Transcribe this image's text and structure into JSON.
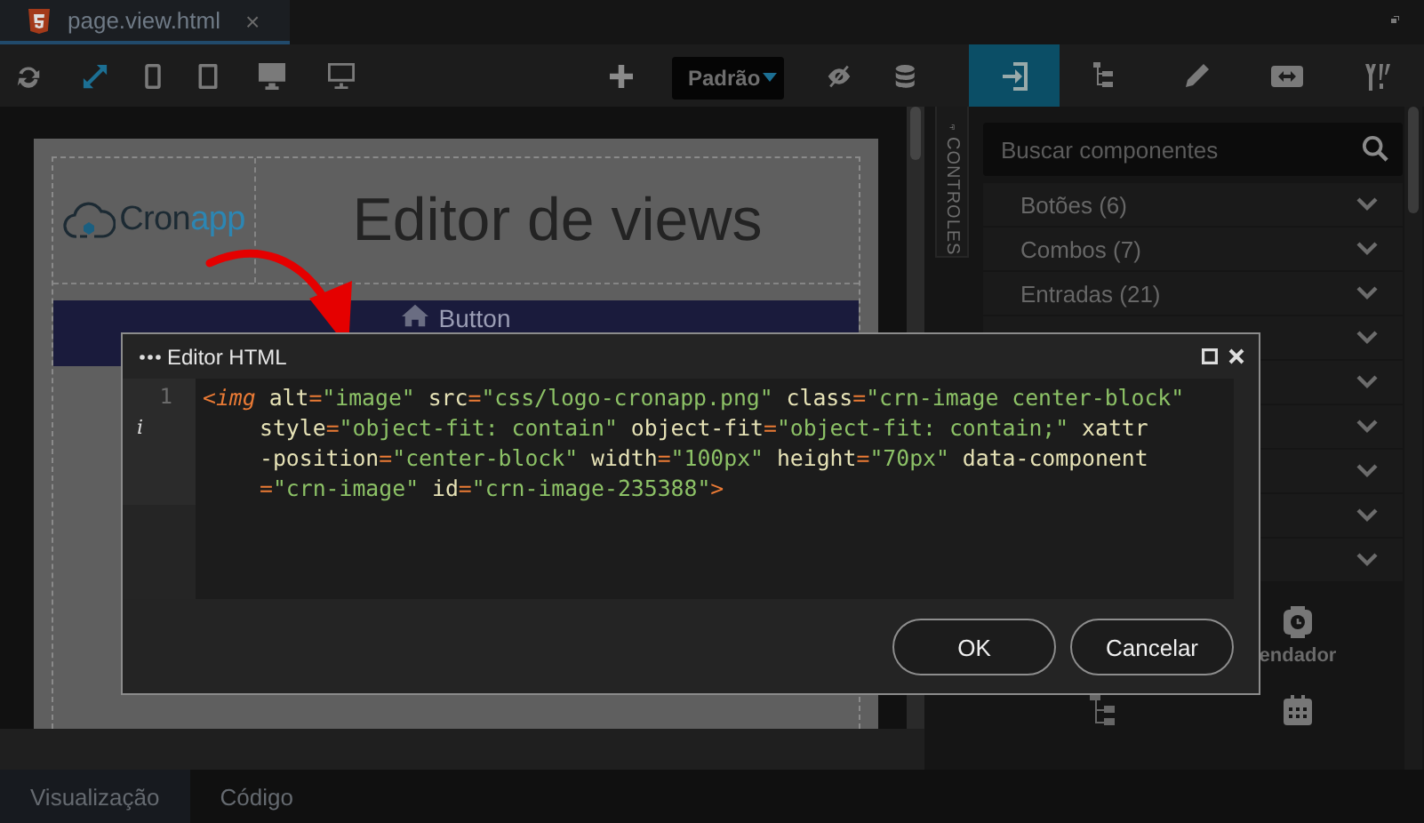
{
  "file_tab": {
    "label": "page.view.html",
    "close": "×",
    "selected": true
  },
  "toolbar": {
    "layout_dropdown": {
      "value": "Padrão"
    }
  },
  "panel_tabs": [
    {
      "selected": true
    },
    {
      "selected": false
    },
    {
      "selected": false
    },
    {
      "selected": false
    },
    {
      "selected": false
    }
  ],
  "side_strip": {
    "label": "CONTROLES"
  },
  "search": {
    "placeholder": "Buscar componentes"
  },
  "accordion": [
    {
      "label": "Botões (6)",
      "expanded": false
    },
    {
      "label": "Combos (7)",
      "expanded": false
    },
    {
      "label": "Entradas (21)",
      "expanded": false
    },
    {
      "expanded": false
    },
    {
      "expanded": false
    },
    {
      "expanded": false
    },
    {
      "expanded": false
    },
    {
      "expanded": false
    },
    {
      "expanded": false
    }
  ],
  "components": [
    {
      "label": "endador"
    }
  ],
  "canvas": {
    "logo_parts": [
      "Cron",
      "app"
    ],
    "title": "Editor de views",
    "button": "Button"
  },
  "dialog": {
    "title": "Editor HTML",
    "line_number": "1",
    "marker": "i",
    "code_lines": [
      "<img alt=\"image\" src=\"css/logo-cronapp.png\" class=\"crn-image center-block\"",
      "style=\"object-fit: contain\" object-fit=\"object-fit: contain;\" xattr",
      "-position=\"center-block\" width=\"100px\" height=\"70px\" data-component",
      "=\"crn-image\" id=\"crn-image-235388\">"
    ],
    "buttons": [
      "OK",
      "Cancelar"
    ]
  },
  "view_tabs": [
    {
      "label": "Visualização",
      "selected": true
    },
    {
      "label": "Código",
      "selected": false
    }
  ]
}
